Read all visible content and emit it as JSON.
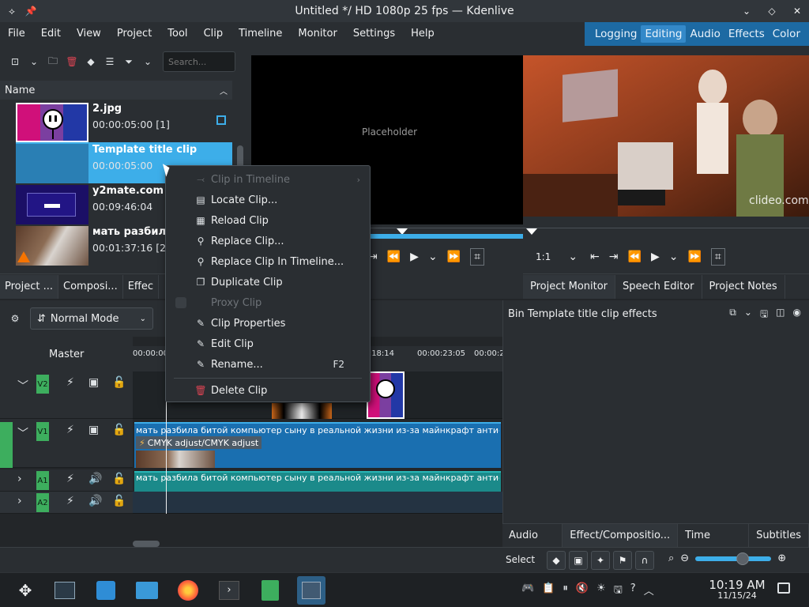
{
  "window": {
    "title": "Untitled */ HD 1080p 25 fps — Kdenlive"
  },
  "menubar": {
    "items": [
      "File",
      "Edit",
      "View",
      "Project",
      "Tool",
      "Clip",
      "Timeline",
      "Monitor",
      "Settings",
      "Help"
    ],
    "layouts": [
      "Logging",
      "Editing",
      "Audio",
      "Effects",
      "Color"
    ],
    "active_layout": "Editing"
  },
  "bin": {
    "search_placeholder": "Search...",
    "column_header": "Name",
    "items": [
      {
        "name": "2.jpg",
        "duration": "00:00:05:00 [1]"
      },
      {
        "name": "Template title clip",
        "duration": "00:00:05:00"
      },
      {
        "name": "y2mate.com -",
        "duration": "00:09:46:04"
      },
      {
        "name": "мать разбила",
        "duration": "00:01:37:16 [2]"
      }
    ],
    "tabs": [
      "Project ...",
      "Composi...",
      "Effec"
    ]
  },
  "clip_monitor": {
    "placeholder": "Placeholder"
  },
  "project_monitor": {
    "watermark": "clideo.com",
    "zoom": "1:1",
    "tabs": [
      "Project Monitor",
      "Speech Editor",
      "Project Notes"
    ]
  },
  "timeline": {
    "mode": "Normal Mode",
    "master_label": "Master",
    "ruler_ticks": [
      "00:00:00",
      "00:00:18:14",
      "00:00:23:05",
      "00:00:2"
    ],
    "tracks": [
      {
        "id": "V2"
      },
      {
        "id": "V1"
      },
      {
        "id": "A1"
      },
      {
        "id": "A2"
      }
    ],
    "v1_clip_label": "мать разбила битой компьютер сыну в реальной жизни из-за майнкрафт анти-грифер",
    "v1_effect_label": "CMYK adjust/CMYK adjust",
    "a1_clip_label": "мать разбила битой компьютер сыну в реальной жизни из-за майнкрафт анти-грифер"
  },
  "effects_panel": {
    "header": "Bin Template title clip effects",
    "tabs": [
      "Audio M...",
      "Effect/Compositio...",
      "Time Rem...",
      "Subtitles"
    ]
  },
  "context_menu": {
    "items": [
      {
        "label": "Clip in Timeline",
        "icon": "clip-in-timeline-icon",
        "glyph": "⤙",
        "disabled": true,
        "submenu": true
      },
      {
        "label": "Locate Clip...",
        "icon": "locate-icon",
        "glyph": "▤"
      },
      {
        "label": "Reload Clip",
        "icon": "reload-icon",
        "glyph": "▦"
      },
      {
        "label": "Replace Clip...",
        "icon": "replace-icon",
        "glyph": "⚲"
      },
      {
        "label": "Replace Clip In Timeline...",
        "icon": "replace-timeline-icon",
        "glyph": "⚲"
      },
      {
        "label": "Duplicate Clip",
        "icon": "duplicate-icon",
        "glyph": "❐"
      },
      {
        "label": "Proxy Clip",
        "icon": "proxy-checkbox",
        "glyph": "",
        "disabled": true
      },
      {
        "label": "Clip Properties",
        "icon": "properties-icon",
        "glyph": "✎"
      },
      {
        "label": "Edit Clip",
        "icon": "edit-icon",
        "glyph": "✎"
      },
      {
        "label": "Rename...",
        "icon": "rename-icon",
        "glyph": "✎",
        "shortcut": "F2"
      },
      {
        "label": "Delete Clip",
        "icon": "trash-icon",
        "glyph": "🗑"
      }
    ]
  },
  "statusbar": {
    "select_label": "Select"
  },
  "taskbar": {
    "time": "10:19 AM",
    "date": "11/15/24"
  }
}
